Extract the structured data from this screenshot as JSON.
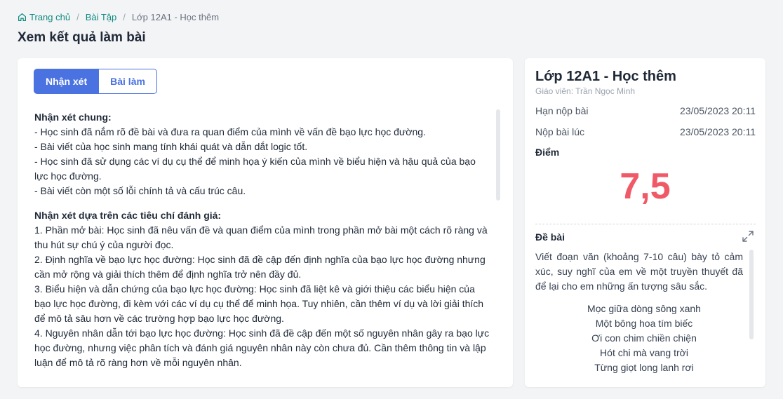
{
  "breadcrumb": {
    "home": "Trang chủ",
    "exercises": "Bài Tập",
    "current": "Lớp 12A1 - Học thêm"
  },
  "page_title": "Xem kết quả làm bài",
  "tabs": {
    "review": "Nhận xét",
    "work": "Bài làm"
  },
  "review": {
    "general_heading": "Nhận xét chung:",
    "general": [
      "- Học sinh đã nắm rõ đề bài và đưa ra quan điểm của mình về vấn đề bạo lực học đường.",
      "- Bài viết của học sinh mang tính khái quát và dẫn dắt logic tốt.",
      "- Học sinh đã sử dụng các ví dụ cụ thể để minh họa ý kiến của mình về biểu hiện và hậu quả của bạo lực học đường.",
      "- Bài viết còn một số lỗi chính tả và cấu trúc câu."
    ],
    "criteria_heading": "Nhận xét dựa trên các tiêu chí đánh giá:",
    "criteria": [
      "1. Phần mở bài: Học sinh đã nêu vấn đề và quan điểm của mình trong phần mở bài một cách rõ ràng và thu hút sự chú ý của người đọc.",
      "2. Định nghĩa về bạo lực học đường: Học sinh đã đề cập đến định nghĩa của bạo lực học đường nhưng cần mở rộng và giải thích thêm để định nghĩa trở nên đầy đủ.",
      "3. Biểu hiện và dẫn chứng của bạo lực học đường: Học sinh đã liệt kê và giới thiệu các biểu hiện của bạo lực học đường, đi kèm với các ví dụ cụ thể để minh họa. Tuy nhiên, cần thêm ví dụ và lời giải thích để mô tả sâu hơn về các trường hợp bạo lực học đường.",
      "4. Nguyên nhân dẫn tới bạo lực học đường: Học sinh đã đề cập đến một số nguyên nhân gây ra bạo lực học đường, nhưng việc phân tích và đánh giá nguyên nhân này còn chưa đủ. Cần thêm thông tin và lập luận để mô tả rõ ràng hơn về mỗi nguyên nhân."
    ]
  },
  "info": {
    "class_name": "Lớp 12A1 - Học thêm",
    "teacher": "Giáo viên: Trần Ngọc Minh",
    "deadline_label": "Hạn nộp bài",
    "deadline_value": "23/05/2023 20:11",
    "submitted_label": "Nộp bài lúc",
    "submitted_value": "23/05/2023 20:11",
    "score_label": "Điểm",
    "score_value": "7,5",
    "assignment_label": "Đề bài",
    "assignment_text": "Viết đoạn văn (khoảng 7-10 câu) bày tỏ cảm xúc, suy nghĩ của em về một truyền thuyết đã để lại cho em những ấn tượng sâu sắc.",
    "poem": [
      "Mọc giữa dòng sông xanh",
      "Một bông hoa tím biếc",
      "Ơi con chim chiền chiện",
      "Hót chi mà vang trời",
      "Từng giọt long lanh rơi"
    ]
  },
  "colors": {
    "accent": "#4a72e0",
    "score": "#f05a68",
    "link": "#0f8a7e"
  }
}
